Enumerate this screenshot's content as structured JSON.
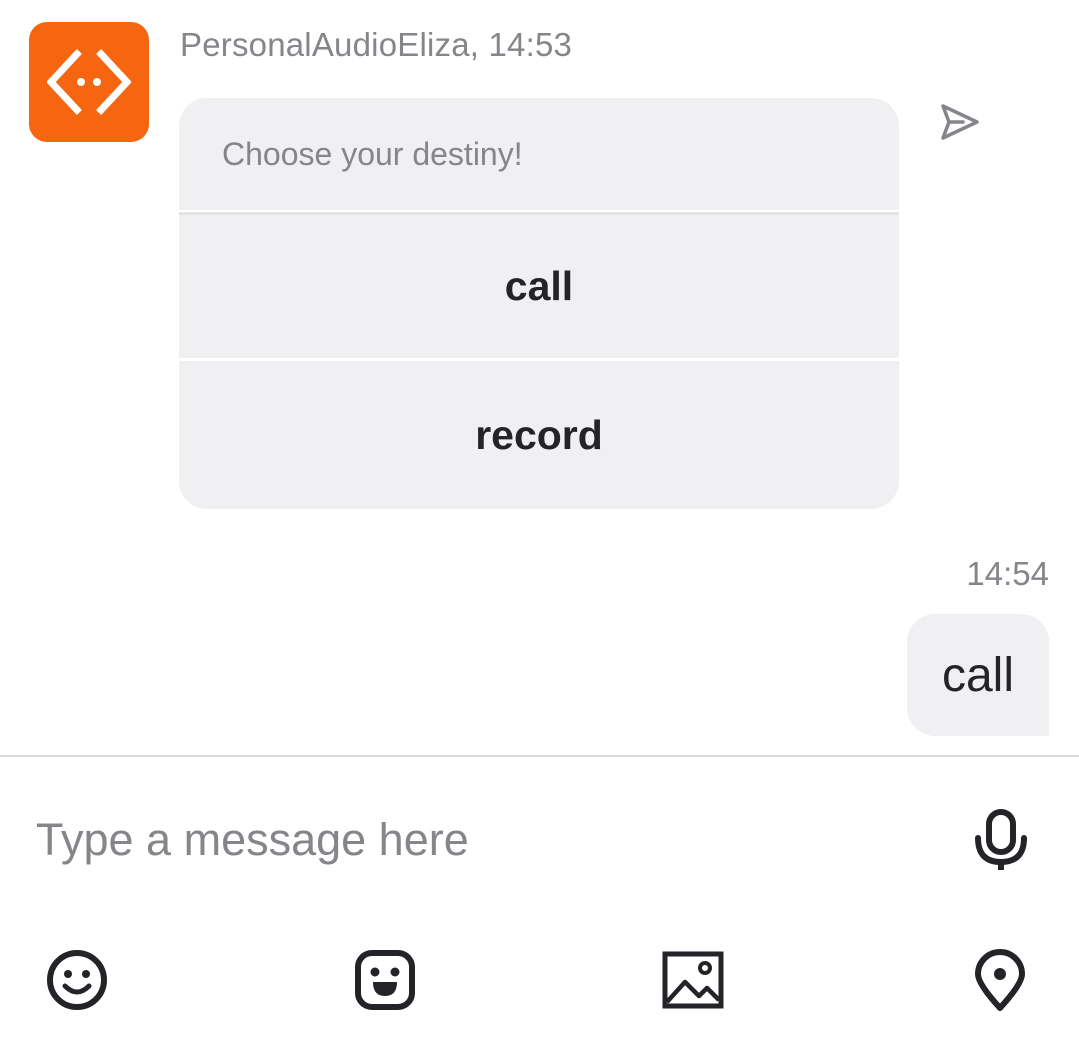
{
  "message_in": {
    "sender_meta": "PersonalAudioEliza, 14:53",
    "avatar_icon": "code-brackets-icon",
    "avatar_color": "#f6650f",
    "prompt": "Choose your destiny!",
    "choices": [
      {
        "label": "call"
      },
      {
        "label": "record"
      }
    ]
  },
  "message_out": {
    "time": "14:54",
    "text": "call"
  },
  "composer": {
    "placeholder": "Type a message here",
    "tools": [
      "emoji-icon",
      "sticker-icon",
      "image-icon",
      "location-icon"
    ],
    "mic_icon": "microphone-icon"
  },
  "colors": {
    "accent": "#f6650f",
    "bubble": "#f0f0f2",
    "meta_text": "#85858a",
    "text": "#232328"
  }
}
